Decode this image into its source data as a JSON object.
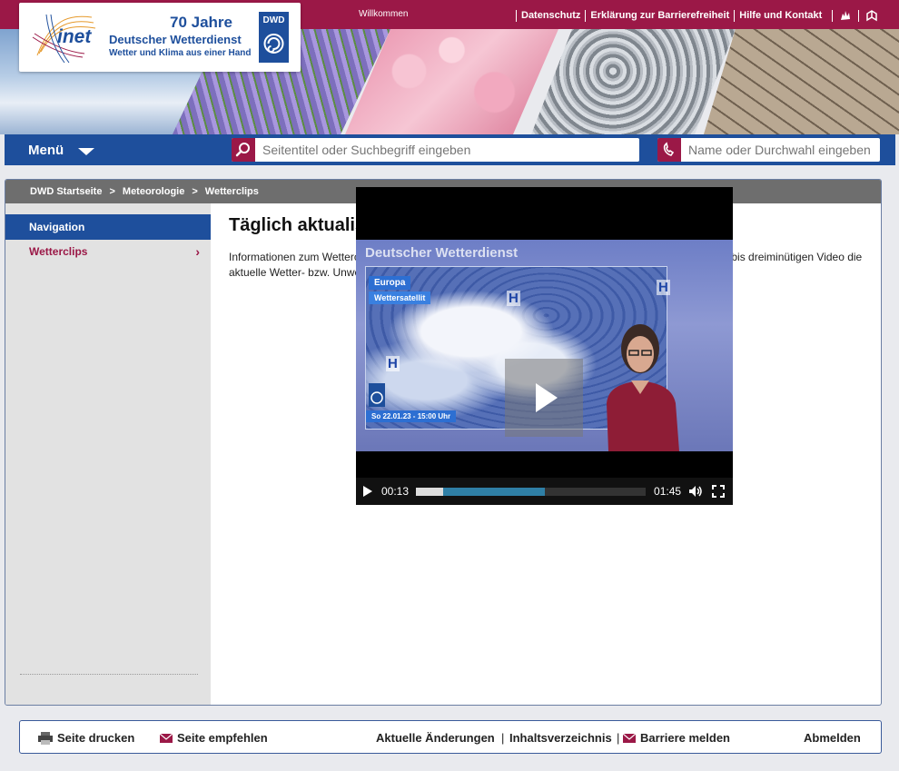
{
  "topbar": {
    "welcome": "Willkommen",
    "links": [
      "Datenschutz",
      "Erklärung zur Barrierefreiheit",
      "Hilfe und Kontakt"
    ],
    "icons": [
      "sign-language-icon",
      "easy-language-icon"
    ]
  },
  "logo": {
    "brand": "inet",
    "line1": "70 Jahre",
    "line2": "Deutscher Wetterdienst",
    "line3": "Wetter und Klima aus einer Hand",
    "badge": "DWD"
  },
  "nav": {
    "menu_label": "Menü",
    "search_placeholder": "Seitentitel oder Suchbegriff eingeben",
    "phone_placeholder": "Name oder Durchwahl eingeben"
  },
  "breadcrumb": [
    "DWD Startseite",
    "Meteorologie",
    "Wetterclips"
  ],
  "sidebar": {
    "heading": "Navigation",
    "items": [
      {
        "label": "Wetterclips"
      }
    ]
  },
  "content": {
    "title": "Täglich aktualisierte Wetterclips",
    "description": "Informationen zum Wetterclip: Durch eine Meteorologin bzw. Meteorologen der VBZ wird in einem zwei- bis dreiminütigen Video die aktuelle Wetter- bzw. Unwetterlage erläutert."
  },
  "video": {
    "frame_title": "Deutscher Wetterdienst",
    "map_label": "Europa",
    "map_sublabel": "Wettersatellit",
    "map_datetime": "So 22.01.23 - 15:00 Uhr",
    "current_time": "00:13",
    "duration": "01:45",
    "played_fraction": 0.12,
    "buffered_fraction": 0.56
  },
  "footer": {
    "print": "Seite drucken",
    "recommend": "Seite empfehlen",
    "changes": "Aktuelle Änderungen",
    "index": "Inhaltsverzeichnis",
    "report": "Barriere melden",
    "logout": "Abmelden"
  },
  "colors": {
    "primary_blue": "#1e4f9c",
    "brand_red": "#9b1847"
  }
}
